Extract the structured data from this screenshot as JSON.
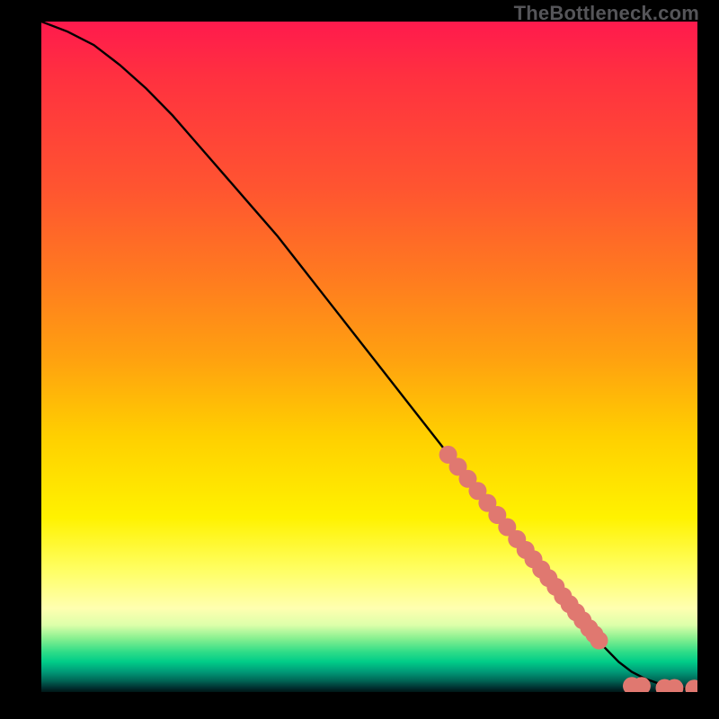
{
  "watermark": "TheBottleneck.com",
  "colors": {
    "dot": "#e07870",
    "curve": "#000000",
    "frame": "#000000"
  },
  "chart_data": {
    "type": "line",
    "title": "",
    "xlabel": "",
    "ylabel": "",
    "xlim": [
      0,
      100
    ],
    "ylim": [
      0,
      100
    ],
    "grid": false,
    "series": [
      {
        "name": "curve",
        "kind": "line",
        "x": [
          0,
          4,
          8,
          12,
          16,
          20,
          24,
          28,
          32,
          36,
          40,
          44,
          48,
          52,
          56,
          60,
          64,
          68,
          72,
          76,
          80,
          84,
          88,
          90,
          92,
          94,
          96,
          98,
          100
        ],
        "y": [
          100,
          98.5,
          96.5,
          93.5,
          90,
          86,
          81.5,
          77,
          72.5,
          68,
          63,
          58,
          53,
          48,
          43,
          38,
          33,
          28,
          23,
          18,
          13,
          8.5,
          4.5,
          3,
          2,
          1.3,
          0.8,
          0.5,
          0.4
        ]
      },
      {
        "name": "cluster-stroke",
        "kind": "scatter",
        "x": [
          62,
          63.5,
          65,
          66.5,
          68,
          69.5,
          71,
          72.5,
          73.8,
          75,
          76.2,
          77.3,
          78.4,
          79.5,
          80.5,
          81.5,
          82.5,
          83.5,
          84.3,
          85
        ],
        "y": [
          35.4,
          33.6,
          31.8,
          30.0,
          28.2,
          26.4,
          24.6,
          22.8,
          21.2,
          19.8,
          18.3,
          17.0,
          15.7,
          14.3,
          13.1,
          11.9,
          10.7,
          9.5,
          8.6,
          7.7
        ]
      },
      {
        "name": "cluster-floor",
        "kind": "scatter",
        "x": [
          90,
          91.5,
          95,
          96.5,
          99.5
        ],
        "y": [
          0.9,
          0.9,
          0.6,
          0.6,
          0.5
        ]
      }
    ]
  }
}
